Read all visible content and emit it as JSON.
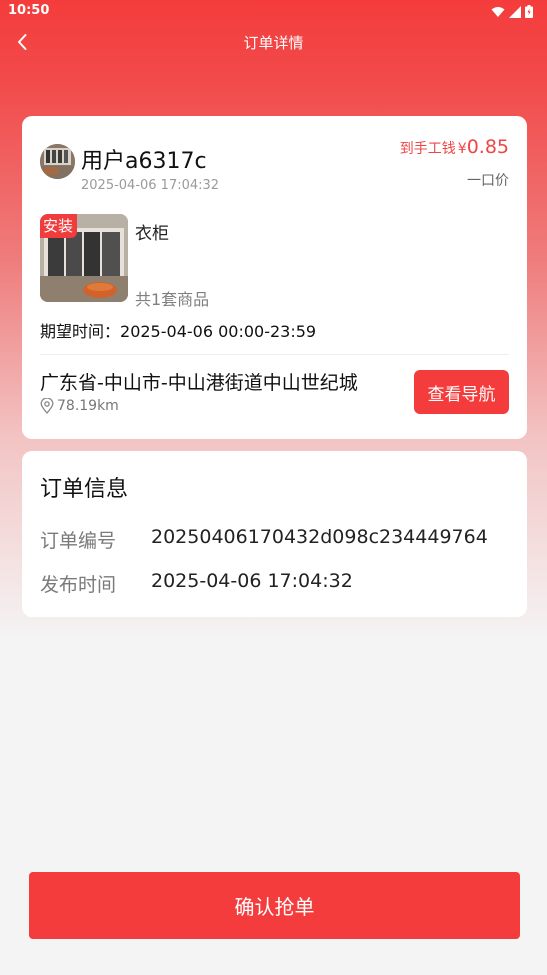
{
  "status_bar": {
    "time": "10:50"
  },
  "header": {
    "title": "订单详情"
  },
  "order_card": {
    "user_name": "用户a6317c",
    "user_time": "2025-04-06 17:04:32",
    "price_label": "到手工钱",
    "price_currency": "¥",
    "price_value": "0.85",
    "price_type": "一口价",
    "tag": "安装",
    "product_name": "衣柜",
    "product_count": "共1套商品",
    "expect_label": "期望时间：",
    "expect_time": "2025-04-06 00:00-23:59",
    "address": "广东省-中山市-中山港街道中山世纪城",
    "distance": "78.19km",
    "nav_button": "查看导航"
  },
  "info_card": {
    "title": "订单信息",
    "rows": [
      {
        "key": "订单编号",
        "value": "20250406170432d098c234449764"
      },
      {
        "key": "发布时间",
        "value": "2025-04-06 17:04:32"
      }
    ]
  },
  "confirm_button": "确认抢单",
  "colors": {
    "accent": "#f43c3c",
    "price": "#f04545",
    "background": "#f4f4f4"
  }
}
